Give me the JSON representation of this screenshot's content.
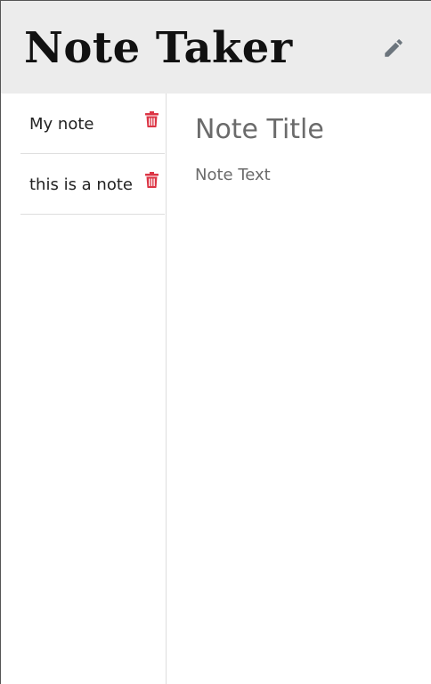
{
  "header": {
    "title": "Note Taker",
    "new_note_icon": "pencil-icon",
    "new_note_icon_color": "#6c757d"
  },
  "notes": [
    {
      "title": "My note",
      "delete_icon": "trash-icon"
    },
    {
      "title": "this is a note",
      "delete_icon": "trash-icon"
    }
  ],
  "editor": {
    "title_placeholder": "Note Title",
    "text_placeholder": "Note Text"
  },
  "colors": {
    "navbar_bg": "#ececec",
    "delete_icon": "#dc3545",
    "placeholder_text": "#6b6b6b",
    "divider": "#dddddd"
  }
}
